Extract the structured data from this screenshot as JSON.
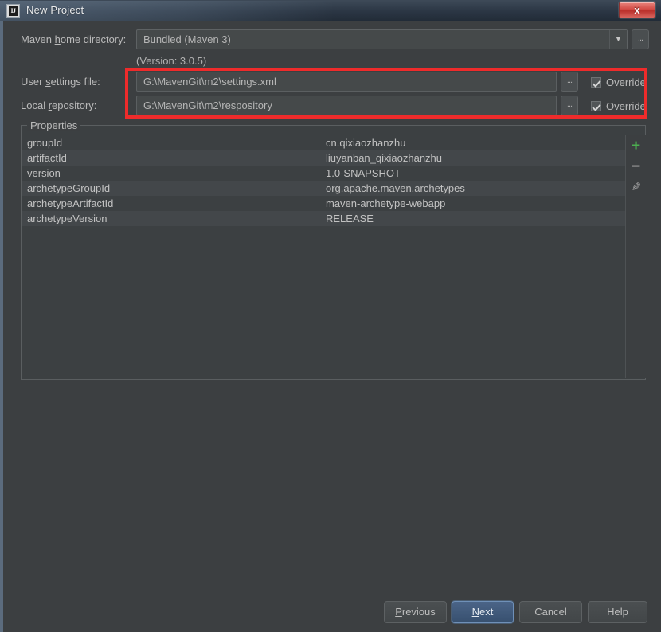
{
  "window": {
    "title": "New Project",
    "app_icon": "intellij-idea-icon",
    "close_label": "x"
  },
  "form": {
    "maven_home_label_pre": "Maven ",
    "maven_home_label_mn": "h",
    "maven_home_label_post": "ome directory:",
    "maven_home_value": "Bundled (Maven 3)",
    "maven_home_arrow": "▼",
    "browse_label": "...",
    "version_text": "(Version: 3.0.5)",
    "user_settings_label_pre": "User ",
    "user_settings_label_mn": "s",
    "user_settings_label_post": "ettings file:",
    "user_settings_value": "G:\\MavenGit\\m2\\settings.xml",
    "local_repo_label_pre": "Local ",
    "local_repo_label_mn": "r",
    "local_repo_label_post": "epository:",
    "local_repo_value": "G:\\MavenGit\\m2\\respository",
    "override_label": "Override",
    "user_settings_override_checked": true,
    "local_repo_override_checked": true
  },
  "properties": {
    "legend": "Properties",
    "rows": [
      {
        "name": "groupId",
        "value": "cn.qixiaozhanzhu"
      },
      {
        "name": "artifactId",
        "value": "liuyanban_qixiaozhanzhu"
      },
      {
        "name": "version",
        "value": "1.0-SNAPSHOT"
      },
      {
        "name": "archetypeGroupId",
        "value": "org.apache.maven.archetypes"
      },
      {
        "name": "archetypeArtifactId",
        "value": "maven-archetype-webapp"
      },
      {
        "name": "archetypeVersion",
        "value": "RELEASE"
      }
    ],
    "toolbar": [
      {
        "icon": "add-icon",
        "glyph": "+",
        "color": "#4caf50"
      },
      {
        "icon": "remove-icon",
        "glyph": "−",
        "color": "#9a9a9a"
      },
      {
        "icon": "edit-pencil-icon",
        "glyph": "✎",
        "color": "#a8a8a8"
      }
    ]
  },
  "footer": {
    "previous_pre": "",
    "previous_mn": "P",
    "previous_post": "revious",
    "next_pre": "",
    "next_mn": "N",
    "next_post": "ext",
    "cancel_label": "Cancel",
    "help_label": "Help"
  },
  "colors": {
    "dialog_bg": "#3c3f41",
    "field_bg": "#45494a",
    "text": "#bbbbbb",
    "annotation_red": "#ee2b2b",
    "default_button_blue": "#4b6487",
    "add_green": "#4caf50"
  }
}
